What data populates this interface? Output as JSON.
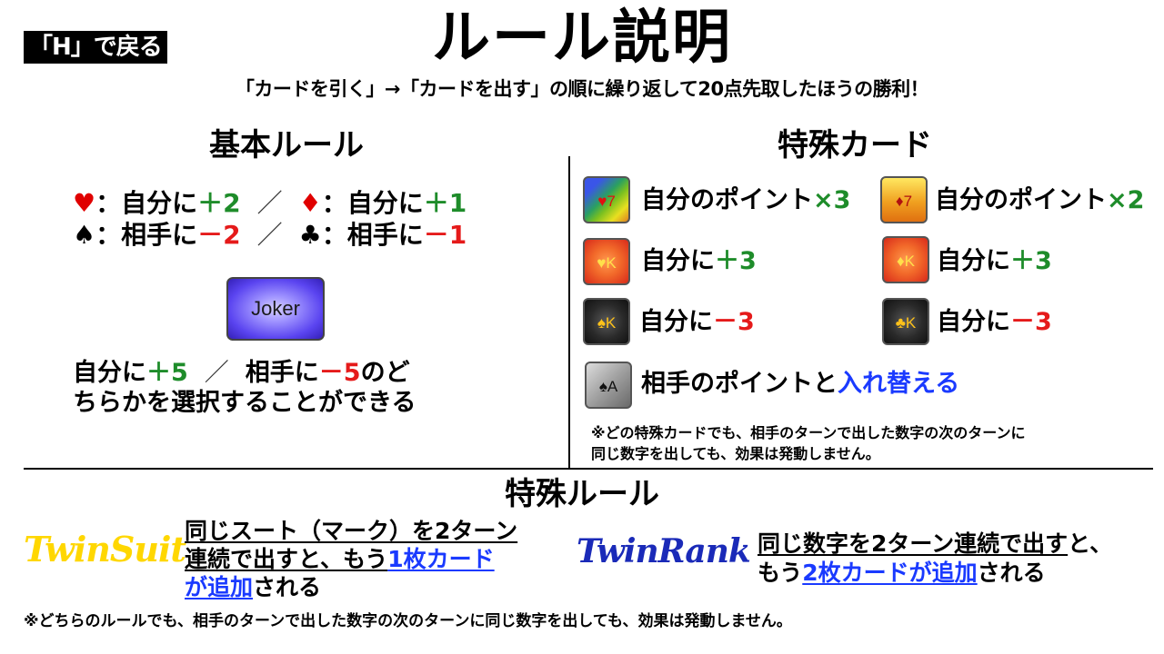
{
  "header": {
    "back_button": "「H」で戻る",
    "title": "ルール説明",
    "subtitle": "「カードを引く」→「カードを出す」の順に繰り返して20点先取したほうの勝利！"
  },
  "basic_rules": {
    "heading": "基本ルール",
    "separator": "／",
    "items": [
      {
        "suit": "♥",
        "text": "：自分に",
        "value": "＋2",
        "color": "#1e8c2a"
      },
      {
        "suit": "♦",
        "text": "：自分に",
        "value": "＋1",
        "color": "#1e8c2a"
      },
      {
        "suit": "♠",
        "text": "：相手に",
        "value": "－2",
        "color": "#e51a1a"
      },
      {
        "suit": "♣",
        "text": "：相手に",
        "value": "－1",
        "color": "#e51a1a"
      }
    ],
    "joker": {
      "label": "Joker",
      "desc_part1": "自分に",
      "desc_value1": "＋5",
      "desc_sep": "／",
      "desc_part2": "相手に",
      "desc_value2": "－5",
      "desc_part3": "のど",
      "desc_line2": "ちらかを選択することができる"
    }
  },
  "special_cards": {
    "heading": "特殊カード",
    "cards": [
      {
        "face": "♥7",
        "prefix": "自分のポイント",
        "effect": "×3"
      },
      {
        "face": "♦7",
        "prefix": "自分のポイント",
        "effect": "×2"
      },
      {
        "face": "♥K",
        "prefix": "自分に",
        "effect": "＋3"
      },
      {
        "face": "♦K",
        "prefix": "自分に",
        "effect": "＋3"
      },
      {
        "face": "♠K",
        "prefix": "自分に",
        "effect": "－3"
      },
      {
        "face": "♣K",
        "prefix": "自分に",
        "effect": "－3"
      },
      {
        "face": "♠A",
        "prefix": "相手のポイントと",
        "effect": "入れ替える"
      }
    ],
    "note_line1": "※どの特殊カードでも、相手のターンで出した数字の次のターンに",
    "note_line2": "同じ数字を出しても、効果は発動しません。"
  },
  "special_rules": {
    "heading": "特殊ルール",
    "twin_suit": {
      "logo": "TwinSuit",
      "line1": "同じスート（マーク）を2ターン",
      "line2_a": "連続で出すと、もう",
      "line2_b": "1枚カード",
      "line3_a": "が追加",
      "line3_b": "される"
    },
    "twin_rank": {
      "logo": "TwinRank",
      "line1_a": "同じ数字を2ターン連続で出す",
      "line1_b": "と、",
      "line2_a": "もう",
      "line2_b": "2枚カードが追加",
      "line2_c": "される"
    },
    "footnote": "※どちらのルールでも、相手のターンで出した数字の次のターンに同じ数字を出しても、効果は発動しません。"
  }
}
